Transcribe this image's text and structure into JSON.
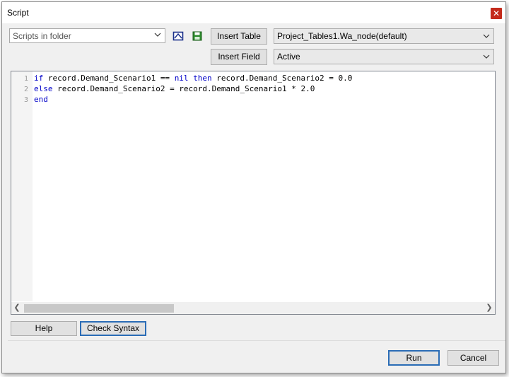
{
  "window": {
    "title": "Script"
  },
  "toolbar": {
    "scripts_combo": "Scripts in folder",
    "insert_table_label": "Insert Table",
    "insert_field_label": "Insert Field",
    "table_combo": "Project_Tables1.Wa_node(default)",
    "field_combo": "Active"
  },
  "editor": {
    "lines": [
      {
        "num": "1",
        "kw1": "if",
        "t1": " record.Demand_Scenario1 == ",
        "kw2": "nil",
        "t2": " ",
        "kw3": "then",
        "t3": " record.Demand_Scenario2 = 0.0"
      },
      {
        "num": "2",
        "kw1": "else",
        "t1": " record.Demand_Scenario2 = record.Demand_Scenario1 * 2.0"
      },
      {
        "num": "3",
        "kw1": "end"
      }
    ]
  },
  "buttons": {
    "help": "Help",
    "check_syntax": "Check Syntax",
    "run": "Run",
    "cancel": "Cancel"
  },
  "icons": {
    "close": "close-icon",
    "open": "open-script-icon",
    "save": "save-icon",
    "dropdown": "chevron-down-icon"
  },
  "colors": {
    "keyword": "#0000c8",
    "close_button": "#c42b1c",
    "focus_border": "#2a6cb6"
  }
}
